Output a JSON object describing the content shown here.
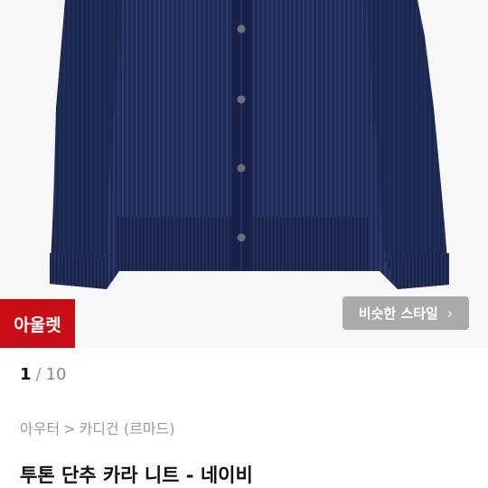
{
  "product": {
    "image_icon": "navy-ribbed-cardigan-photo",
    "badge_label": "아울렛",
    "similar_style_label": "비슷한 스타일",
    "similar_style_chevron": "›",
    "pager": {
      "current": "1",
      "separator": "/",
      "total": "10"
    },
    "breadcrumb": {
      "category": "아우터",
      "arrow": ">",
      "subcategory": "카디건 (르마드)"
    },
    "title": "투톤 단추 카라 니트 - 네이비"
  },
  "colors": {
    "badge": "#c70e14",
    "garment": "#1f2a54"
  }
}
